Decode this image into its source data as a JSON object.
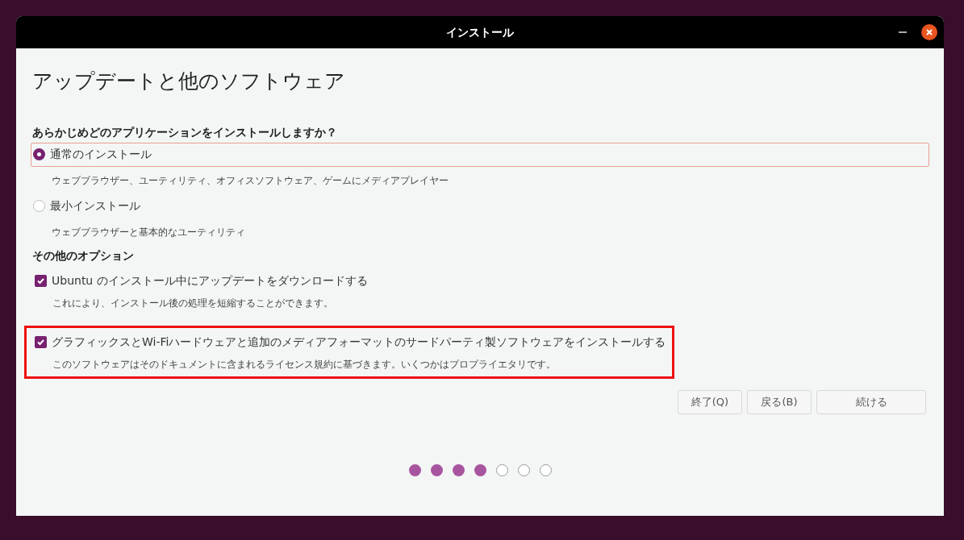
{
  "window": {
    "title": "インストール"
  },
  "heading": "アップデートと他のソフトウェア",
  "question": "あらかじめどのアプリケーションをインストールしますか？",
  "install_types": [
    {
      "label": "通常のインストール",
      "description": "ウェブブラウザー、ユーティリティ、オフィスソフトウェア、ゲームにメディアプレイヤー",
      "selected": true,
      "focused": true
    },
    {
      "label": "最小インストール",
      "description": "ウェブブラウザーと基本的なユーティリティ",
      "selected": false,
      "focused": false
    }
  ],
  "other_heading": "その他のオプション",
  "options": [
    {
      "label": "Ubuntu のインストール中にアップデートをダウンロードする",
      "description": "これにより、インストール後の処理を短縮することができます。",
      "checked": true,
      "highlighted": false
    },
    {
      "label": "グラフィックスとWi-Fiハードウェアと追加のメディアフォーマットのサードパーティ製ソフトウェアをインストールする",
      "description": "このソフトウェアはそのドキュメントに含まれるライセンス規約に基づきます。いくつかはプロプライエタリです。",
      "checked": true,
      "highlighted": true
    }
  ],
  "buttons": [
    "終了(Q)",
    "戻る(B)",
    "続ける"
  ],
  "progress": [
    {
      "done": true
    },
    {
      "done": true
    },
    {
      "done": true
    },
    {
      "done": true
    },
    {
      "done": false
    },
    {
      "done": false
    },
    {
      "done": false
    }
  ]
}
